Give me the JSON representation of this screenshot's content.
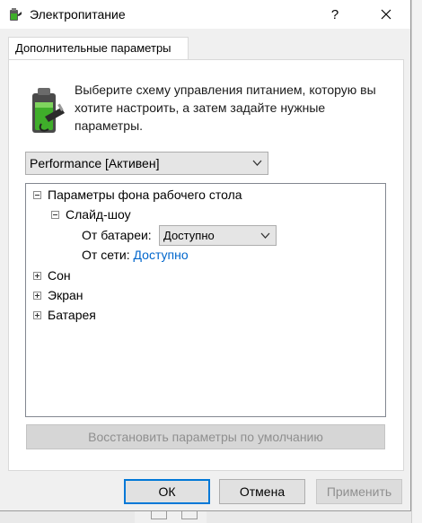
{
  "window": {
    "title": "Электропитание",
    "help_label": "?",
    "close_label": "✕"
  },
  "tab": {
    "label": "Дополнительные параметры"
  },
  "description": "Выберите схему управления питанием, которую вы хотите настроить, а затем задайте нужные параметры.",
  "plan_select": {
    "value": "Performance [Активен]"
  },
  "tree": {
    "desktop_background": "Параметры фона рабочего стола",
    "slideshow": "Слайд-шоу",
    "on_battery_label": "От батареи:",
    "on_battery_value": "Доступно",
    "plugged_in_label": "От сети:",
    "plugged_in_value": "Доступно",
    "sleep": "Сон",
    "display": "Экран",
    "battery": "Батарея"
  },
  "restore_button": "Восстановить параметры по умолчанию",
  "buttons": {
    "ok": "ОК",
    "cancel": "Отмена",
    "apply": "Применить"
  },
  "colors": {
    "link": "#0066cc",
    "focus_border": "#0078d7",
    "battery_green": "#3fae2a"
  },
  "icons": {
    "title": "power-options-icon",
    "description": "battery-plug-icon"
  }
}
